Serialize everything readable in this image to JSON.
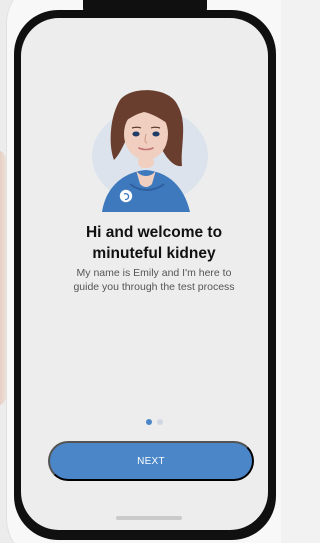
{
  "onboarding": {
    "title": "Hi and welcome to\nminuteful kidney",
    "subtitle": "My name is Emily and I'm here to\nguide you through the test process",
    "next_button_label": "NEXT",
    "current_page": 1,
    "total_pages": 2
  },
  "illustration": {
    "character_name": "Emily",
    "subject": "nurse-avatar"
  },
  "colors": {
    "accent": "#4A86C8",
    "background": "#EDEDED",
    "text_primary": "#111111",
    "text_secondary": "#555555",
    "dot_inactive": "#D0D7E2"
  }
}
